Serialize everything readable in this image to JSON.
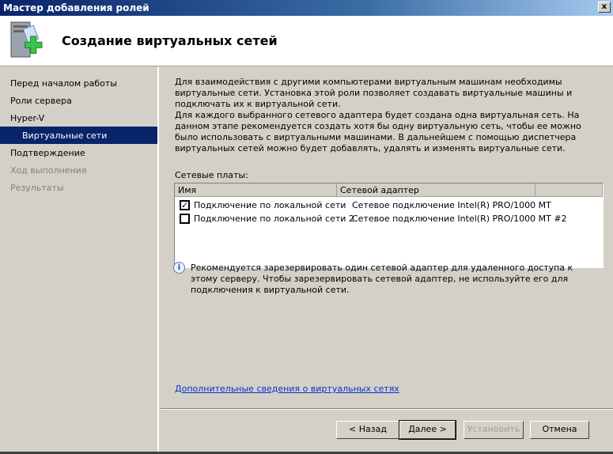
{
  "window": {
    "title": "Мастер добавления ролей",
    "close": "x"
  },
  "header": {
    "title": "Создание виртуальных сетей"
  },
  "sidebar": {
    "items": [
      {
        "label": "Перед началом работы",
        "state": "normal"
      },
      {
        "label": "Роли сервера",
        "state": "normal"
      },
      {
        "label": "Hyper-V",
        "state": "normal"
      },
      {
        "label": "Виртуальные сети",
        "state": "selected"
      },
      {
        "label": "Подтверждение",
        "state": "normal"
      },
      {
        "label": "Ход выполнения",
        "state": "disabled"
      },
      {
        "label": "Результаты",
        "state": "disabled"
      }
    ]
  },
  "main": {
    "intro1": "Для взаимодействия с другими компьютерами виртуальным машинам необходимы виртуальные сети. Установка этой роли позволяет создавать виртуальные машины и подключать их к виртуальной сети.",
    "intro2": "Для каждого выбранного сетевого адаптера будет создана одна виртуальная сеть. На данном этапе рекомендуется создать хотя бы одну виртуальную сеть, чтобы ее можно было использовать с виртуальными машинами. В дальнейшем с помощью диспетчера виртуальных сетей можно будет добавлять, удалять и изменять виртуальные сети.",
    "list_label": "Сетевые платы:",
    "columns": [
      "Имя",
      "Сетевой адаптер"
    ],
    "rows": [
      {
        "checked": true,
        "name": "Подключение по локальной сети",
        "adapter": "Сетевое подключение Intel(R) PRO/1000 MT"
      },
      {
        "checked": false,
        "name": "Подключение по локальной сети 2",
        "adapter": "Сетевое подключение Intel(R) PRO/1000 MT #2"
      }
    ],
    "info": "Рекомендуется зарезервировать один сетевой адаптер для удаленного доступа к этому серверу. Чтобы зарезервировать сетевой адаптер, не используйте его для подключения к виртуальной сети.",
    "link": "Дополнительные сведения о виртуальных сетях"
  },
  "buttons": {
    "back": "< Назад",
    "next": "Далее >",
    "install": "Установить",
    "cancel": "Отмена"
  }
}
